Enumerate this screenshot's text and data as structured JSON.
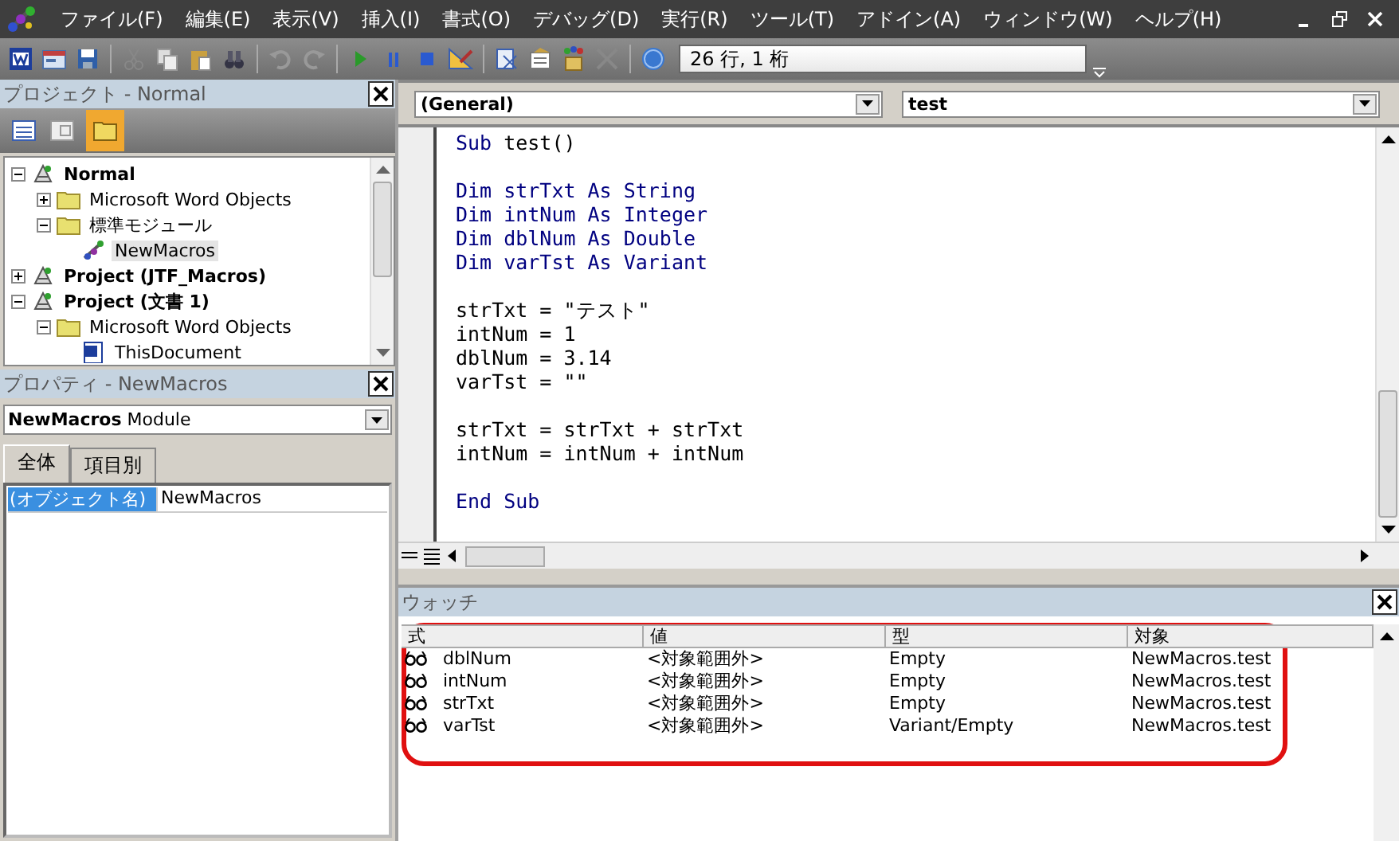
{
  "menu": [
    "ファイル(F)",
    "編集(E)",
    "表示(V)",
    "挿入(I)",
    "書式(O)",
    "デバッグ(D)",
    "実行(R)",
    "ツール(T)",
    "アドイン(A)",
    "ウィンドウ(W)",
    "ヘルプ(H)"
  ],
  "toolbar": {
    "position": "26 行, 1 桁"
  },
  "project": {
    "title": "プロジェクト - Normal",
    "tree": [
      {
        "label": "Normal",
        "kind": "project",
        "expanded": true,
        "selected": false,
        "children": [
          {
            "label": "Microsoft Word Objects",
            "kind": "folder",
            "expanded": false,
            "selected": false
          },
          {
            "label": "標準モジュール",
            "kind": "folder",
            "expanded": true,
            "selected": false,
            "children": [
              {
                "label": "NewMacros",
                "kind": "module",
                "selected": true
              }
            ]
          }
        ]
      },
      {
        "label": "Project (JTF_Macros)",
        "kind": "project",
        "expanded": false,
        "selected": false
      },
      {
        "label": "Project (文書 1)",
        "kind": "project",
        "expanded": true,
        "selected": false,
        "children": [
          {
            "label": "Microsoft Word Objects",
            "kind": "folder",
            "expanded": true,
            "selected": false,
            "children": [
              {
                "label": "ThisDocument",
                "kind": "document",
                "selected": false
              }
            ]
          }
        ]
      }
    ]
  },
  "properties": {
    "title": "プロパティ - NewMacros",
    "object": "**NewMacros** Module",
    "tabs": [
      {
        "label": "全体",
        "selected": true
      },
      {
        "label": "項目別",
        "selected": false
      }
    ],
    "rows": [
      {
        "name": "(オブジェクト名)",
        "value": "NewMacros",
        "selected": true
      }
    ]
  },
  "editor": {
    "object": "(General)",
    "procedure": "test",
    "blocks": [
      [
        [
          {
            "text": "Sub",
            "kind": "keyword"
          },
          {
            "text": " test()",
            "kind": "plain"
          }
        ]
      ],
      [
        [
          {
            "text": "Dim strTxt As String",
            "kind": "keyword"
          }
        ],
        [
          {
            "text": "Dim intNum As Integer",
            "kind": "keyword"
          }
        ],
        [
          {
            "text": "Dim dblNum As Double",
            "kind": "keyword"
          }
        ],
        [
          {
            "text": "Dim varTst As Variant",
            "kind": "keyword"
          }
        ]
      ],
      [
        [
          {
            "text": "strTxt = \"テスト\"",
            "kind": "plain"
          }
        ],
        [
          {
            "text": "intNum = 1",
            "kind": "plain"
          }
        ],
        [
          {
            "text": "dblNum = 3.14",
            "kind": "plain"
          }
        ],
        [
          {
            "text": "varTst = \"\"",
            "kind": "plain"
          }
        ]
      ],
      [
        [
          {
            "text": "strTxt = strTxt + strTxt",
            "kind": "plain"
          }
        ],
        [
          {
            "text": "intNum = intNum + intNum",
            "kind": "plain"
          }
        ]
      ],
      [
        [
          {
            "text": "End Sub",
            "kind": "keyword"
          }
        ]
      ]
    ]
  },
  "watch": {
    "title": "ウォッチ",
    "columns": [
      "式",
      "値",
      "型",
      "対象"
    ],
    "rows": [
      [
        "dblNum",
        "<対象範囲外>",
        "Empty",
        "NewMacros.test"
      ],
      [
        "intNum",
        "<対象範囲外>",
        "Empty",
        "NewMacros.test"
      ],
      [
        "strTxt",
        "<対象範囲外>",
        "Empty",
        "NewMacros.test"
      ],
      [
        "varTst",
        "<対象範囲外>",
        "Variant/Empty",
        "NewMacros.test"
      ]
    ]
  }
}
